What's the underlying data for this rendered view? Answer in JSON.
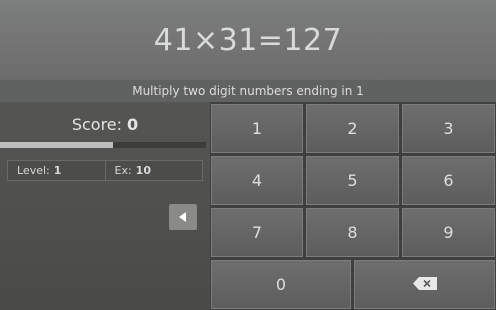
{
  "problem": {
    "equation": "41×31=127"
  },
  "hint": {
    "text": "Multiply two digit numbers ending in 1"
  },
  "score": {
    "label": "Score:",
    "value": "0",
    "progress_fraction": 0.55
  },
  "stats": {
    "level_label": "Level:",
    "level_value": "1",
    "ex_label": "Ex:",
    "ex_value": "10"
  },
  "keypad": {
    "keys": [
      "1",
      "2",
      "3",
      "4",
      "5",
      "6",
      "7",
      "8",
      "9",
      "0"
    ],
    "backspace_icon": "backspace-icon"
  },
  "colors": {
    "accent_bar": "#bdbdbd",
    "key_face": "#666766"
  }
}
